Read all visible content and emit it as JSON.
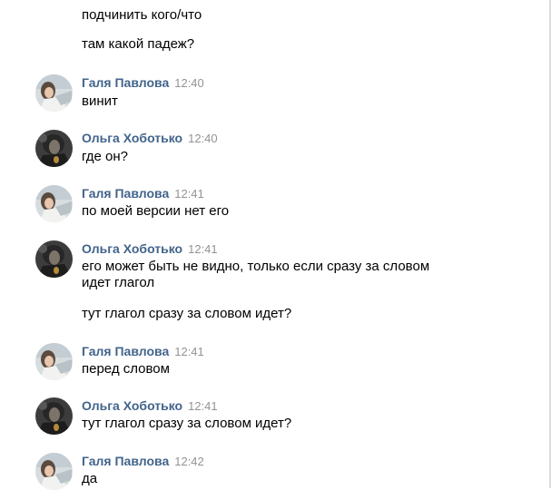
{
  "conversation": {
    "leading_messages": [
      "подчинить кого/что",
      "там какой падеж?"
    ],
    "messages": [
      {
        "author": "Галя Павлова",
        "time": "12:40",
        "lines": [
          "винит"
        ]
      },
      {
        "author": "Ольга Хоботько",
        "time": "12:40",
        "lines": [
          "где он?"
        ]
      },
      {
        "author": "Галя Павлова",
        "time": "12:41",
        "lines": [
          "по моей версии нет его"
        ]
      },
      {
        "author": "Ольга Хоботько",
        "time": "12:41",
        "lines": [
          "его может быть не видно, только если сразу за словом",
          "идет глагол",
          "тут глагол сразу за словом идет?"
        ]
      },
      {
        "author": "Галя Павлова",
        "time": "12:41",
        "lines": [
          "перед словом"
        ]
      },
      {
        "author": "Ольга Хоботько",
        "time": "12:41",
        "lines": [
          "тут глагол сразу за словом идет?"
        ]
      },
      {
        "author": "Галя Павлова",
        "time": "12:42",
        "lines": [
          "да"
        ]
      }
    ]
  },
  "colors": {
    "author_name": "#42648b",
    "timestamp": "#939393",
    "message_text": "#000000",
    "background": "#ffffff"
  },
  "icons": {
    "galya_avatar": "galya-avatar-photo",
    "olga_avatar": "olga-avatar-photo"
  }
}
